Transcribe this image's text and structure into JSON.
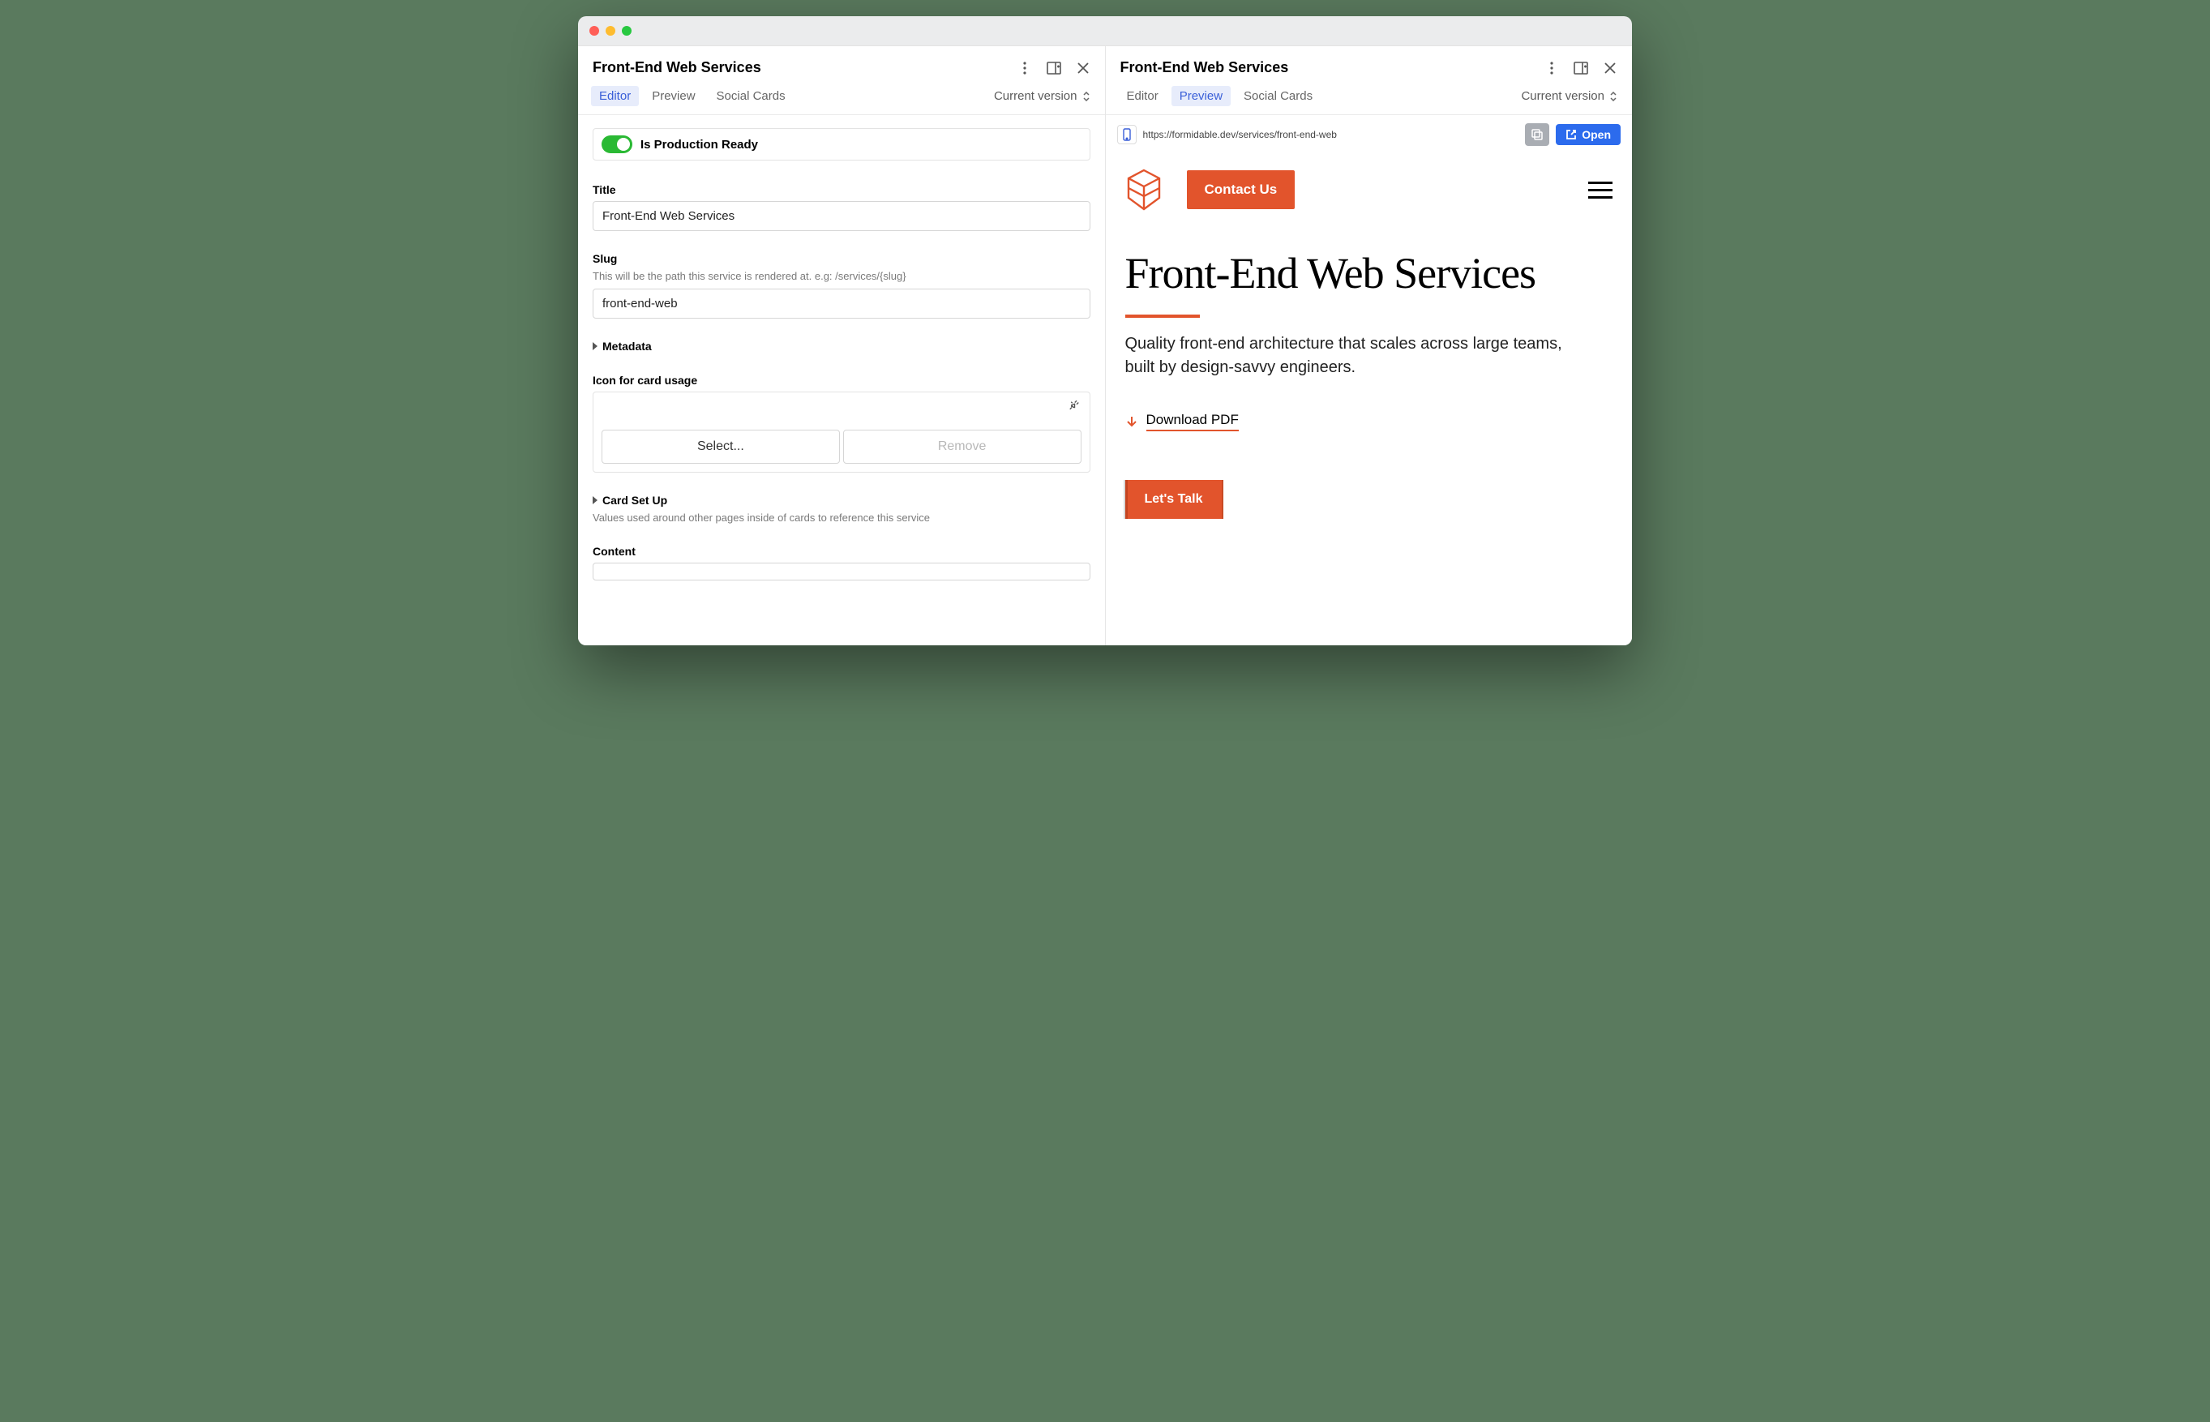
{
  "left": {
    "title": "Front-End Web Services",
    "tabs": [
      "Editor",
      "Preview",
      "Social Cards"
    ],
    "active_tab": 0,
    "version_label": "Current version",
    "fields": {
      "toggle_label": "Is Production Ready",
      "title_label": "Title",
      "title_value": "Front-End Web Services",
      "slug_label": "Slug",
      "slug_help": "This will be the path this service is rendered at. e.g: /services/{slug}",
      "slug_value": "front-end-web",
      "metadata_label": "Metadata",
      "icon_label": "Icon for card usage",
      "select_label": "Select...",
      "remove_label": "Remove",
      "cardsetup_label": "Card Set Up",
      "cardsetup_help": "Values used around other pages inside of cards to reference this service",
      "content_label": "Content"
    }
  },
  "right": {
    "title": "Front-End Web Services",
    "tabs": [
      "Editor",
      "Preview",
      "Social Cards"
    ],
    "active_tab": 1,
    "version_label": "Current version",
    "url": "https://formidable.dev/services/front-end-web",
    "open_label": "Open",
    "site": {
      "contact_label": "Contact Us",
      "hero_title": "Front-End Web Services",
      "hero_sub": "Quality front-end architecture that scales across large teams, built by design-savvy engineers.",
      "download_label": "Download PDF",
      "cta_label": "Let's Talk"
    }
  }
}
